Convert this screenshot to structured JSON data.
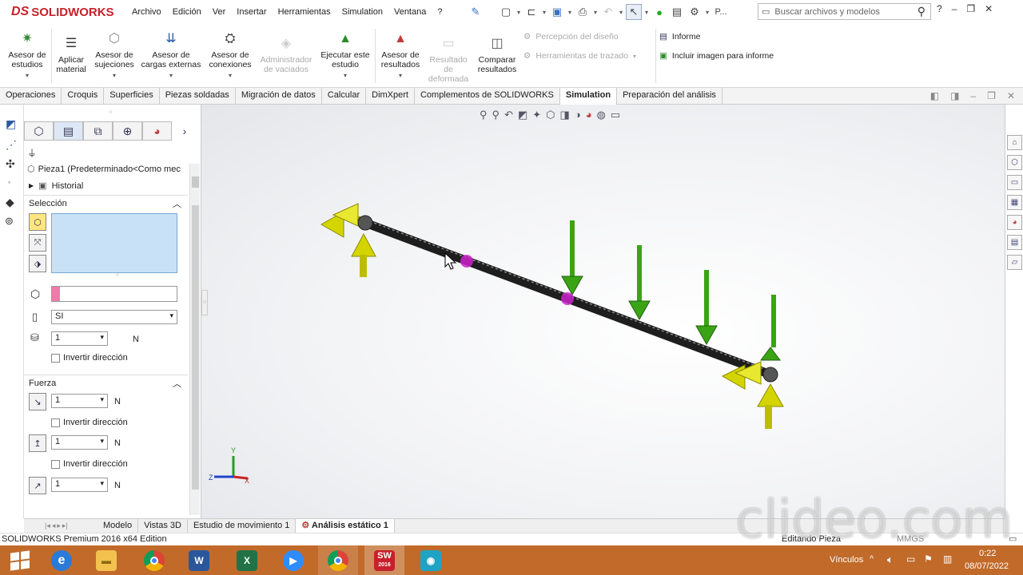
{
  "app": {
    "logo": "SOLIDWORKS",
    "logo_prefix": "DS"
  },
  "menu": [
    "Archivo",
    "Edición",
    "Ver",
    "Insertar",
    "Herramientas",
    "Simulation",
    "Ventana",
    "?"
  ],
  "quick": {
    "overflow": "P..."
  },
  "search": {
    "placeholder": "Buscar archivos y modelos"
  },
  "ribbon": {
    "asesor_estudios": "Asesor de estudios",
    "aplicar_material": "Aplicar material",
    "asesor_sujeciones": "Asesor de sujeciones",
    "asesor_cargas": "Asesor de cargas externas",
    "asesor_conexiones": "Asesor de conexiones",
    "admin_vaciados": "Administrador de vaciados",
    "ejecutar": "Ejecutar este estudio",
    "asesor_resultados": "Asesor de resultados",
    "resultado_deformada": "Resultado de deformada",
    "comparar": "Comparar resultados",
    "percepcion": "Percepción del diseño",
    "herramientas_trazado": "Herramientas de trazado",
    "informe": "Informe",
    "incluir_imagen": "Incluir imagen para informe"
  },
  "tabs": [
    "Operaciones",
    "Croquis",
    "Superficies",
    "Piezas soldadas",
    "Migración de datos",
    "Calcular",
    "DimXpert",
    "Complementos de SOLIDWORKS",
    "Simulation",
    "Preparación del análisis"
  ],
  "active_tab": "Simulation",
  "panel": {
    "tree_root": "Pieza1  (Predeterminado<Como mec",
    "historial": "Historial",
    "seleccion_title": "Selección",
    "units": "SI",
    "value1": "1",
    "unit_n": "N",
    "invertir": "Invertir dirección",
    "fuerza_title": "Fuerza",
    "f1": "1",
    "f2": "1",
    "f3": "1"
  },
  "triad": {
    "x": "X",
    "y": "Y",
    "z": "Z"
  },
  "bottom_tabs": [
    "Modelo",
    "Vistas 3D",
    "Estudio de movimiento 1",
    "Análisis estático 1"
  ],
  "active_bottom_tab": "Análisis estático 1",
  "status": {
    "left": "SOLIDWORKS Premium 2016 x64 Edition",
    "right": "Editando Pieza",
    "units": "MMGS"
  },
  "taskbar": {
    "links": "Vínculos",
    "time": "0:22",
    "date": "08/07/2022",
    "sw_version": "2016"
  },
  "watermark": "clideo.com",
  "colors": {
    "accent": "#c8202a",
    "taskbar": "#c16a2a",
    "arrow_yellow": "#d4d400",
    "arrow_green": "#3aa415",
    "magenta": "#cc22cc"
  }
}
